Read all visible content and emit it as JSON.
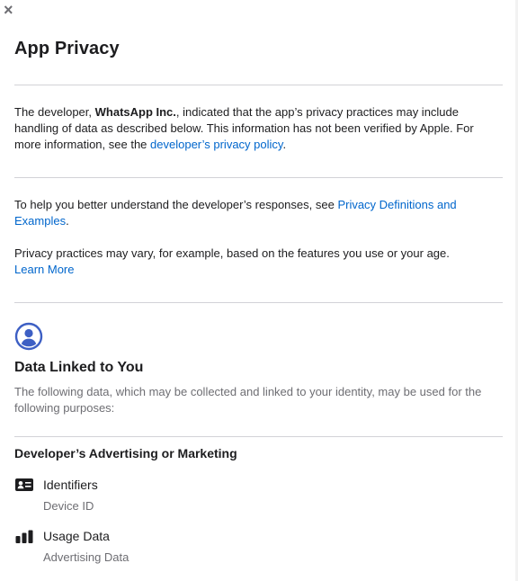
{
  "modal": {
    "close_symbol": "×",
    "title": "App Privacy"
  },
  "intro": {
    "p1_before": "The developer, ",
    "developer_name": "WhatsApp Inc.",
    "p1_after": ", indicated that the app’s privacy practices may include handling of data as described below. This information has not been verified by Apple. For more information, see the ",
    "policy_link": "developer’s privacy policy",
    "p1_end": "."
  },
  "help": {
    "p2_before": "To help you better understand the developer’s responses, see ",
    "definitions_link": "Privacy Definitions and Examples",
    "p2_end": ".",
    "p3": "Privacy practices may vary, for example, based on the features you use or your age.",
    "learn_more_link": "Learn More"
  },
  "section": {
    "icon": "person-circle-icon",
    "title": "Data Linked to You",
    "description": "The following data, which may be collected and linked to your identity, may be used for the following purposes:"
  },
  "purpose": {
    "title": "Developer’s Advertising or Marketing",
    "categories": [
      {
        "icon": "id-card-icon",
        "name": "Identifiers",
        "detail": "Device ID"
      },
      {
        "icon": "bar-chart-icon",
        "name": "Usage Data",
        "detail": "Advertising Data"
      }
    ]
  },
  "colors": {
    "link": "#0066cc",
    "accent_icon": "#3d5fc4",
    "text": "#1d1d1f",
    "secondary_text": "#6e6e73",
    "divider": "#d2d2d7"
  }
}
